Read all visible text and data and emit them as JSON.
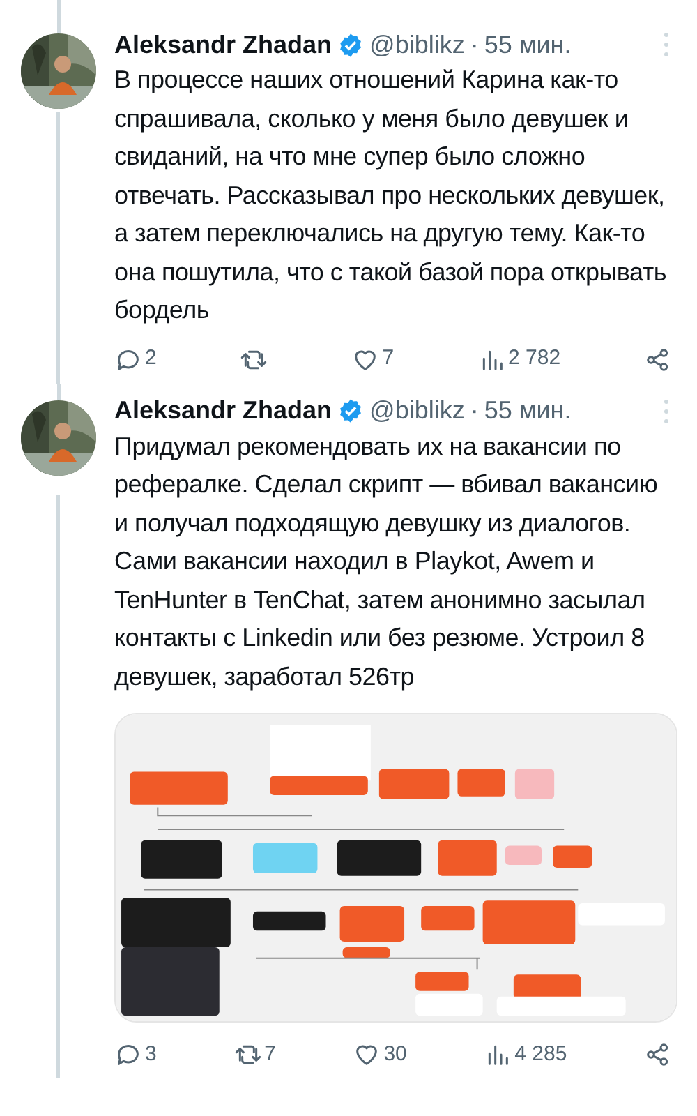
{
  "tweets": [
    {
      "author": "Aleksandr Zhadan",
      "verified": true,
      "handle": "@biblikz",
      "separator": "·",
      "time": "55 мин.",
      "text": "В процессе наших отношений Карина как-то спрашивала, сколько у меня было девушек и свиданий, на что мне супер было сложно отвечать. Рассказывал про нескольких девушек, а затем переключались на другую тему. Как-то она пошутила, что с такой базой пора открывать бордель",
      "actions": {
        "replies": "2",
        "likes": "7",
        "views": "2 782"
      }
    },
    {
      "author": "Aleksandr Zhadan",
      "verified": true,
      "handle": "@biblikz",
      "separator": "·",
      "time": "55 мин.",
      "text": "Придумал рекомендовать их на вакансии по рефералке. Сделал скрипт — вбивал вакансию и получал подходящую девушку из диалогов. Сами вакансии находил в Playkot, Awem и TenHunter в TenChat, затем анонимно засылал контакты с Linkedin или без резюме. Устроил 8 девушек, заработал 526тр",
      "actions": {
        "replies": "3",
        "reposts": "7",
        "likes": "30",
        "views": "4 285"
      }
    }
  ]
}
